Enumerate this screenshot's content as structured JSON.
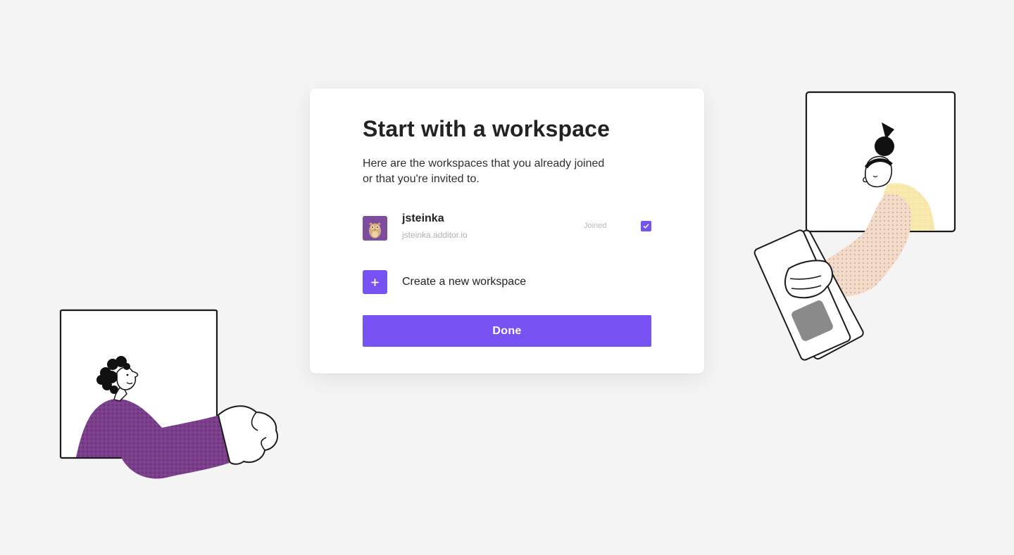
{
  "onboarding": {
    "title": "Start with a workspace",
    "subtitle": "Here are the workspaces that you already joined or that you're invited to.",
    "workspaces": [
      {
        "name": "jsteinka",
        "domain": "jsteinka.additor.io",
        "status": "Joined",
        "checked": true,
        "avatar": "owl-avatar"
      }
    ],
    "create": {
      "icon": "plus-icon",
      "label": "Create a new workspace"
    },
    "done_label": "Done"
  },
  "colors": {
    "accent": "#7652f2",
    "background": "#f4f4f4",
    "card": "#ffffff",
    "sweater_purple": "#7b3f8c",
    "sweater_yellow": "#f6e6a8"
  }
}
